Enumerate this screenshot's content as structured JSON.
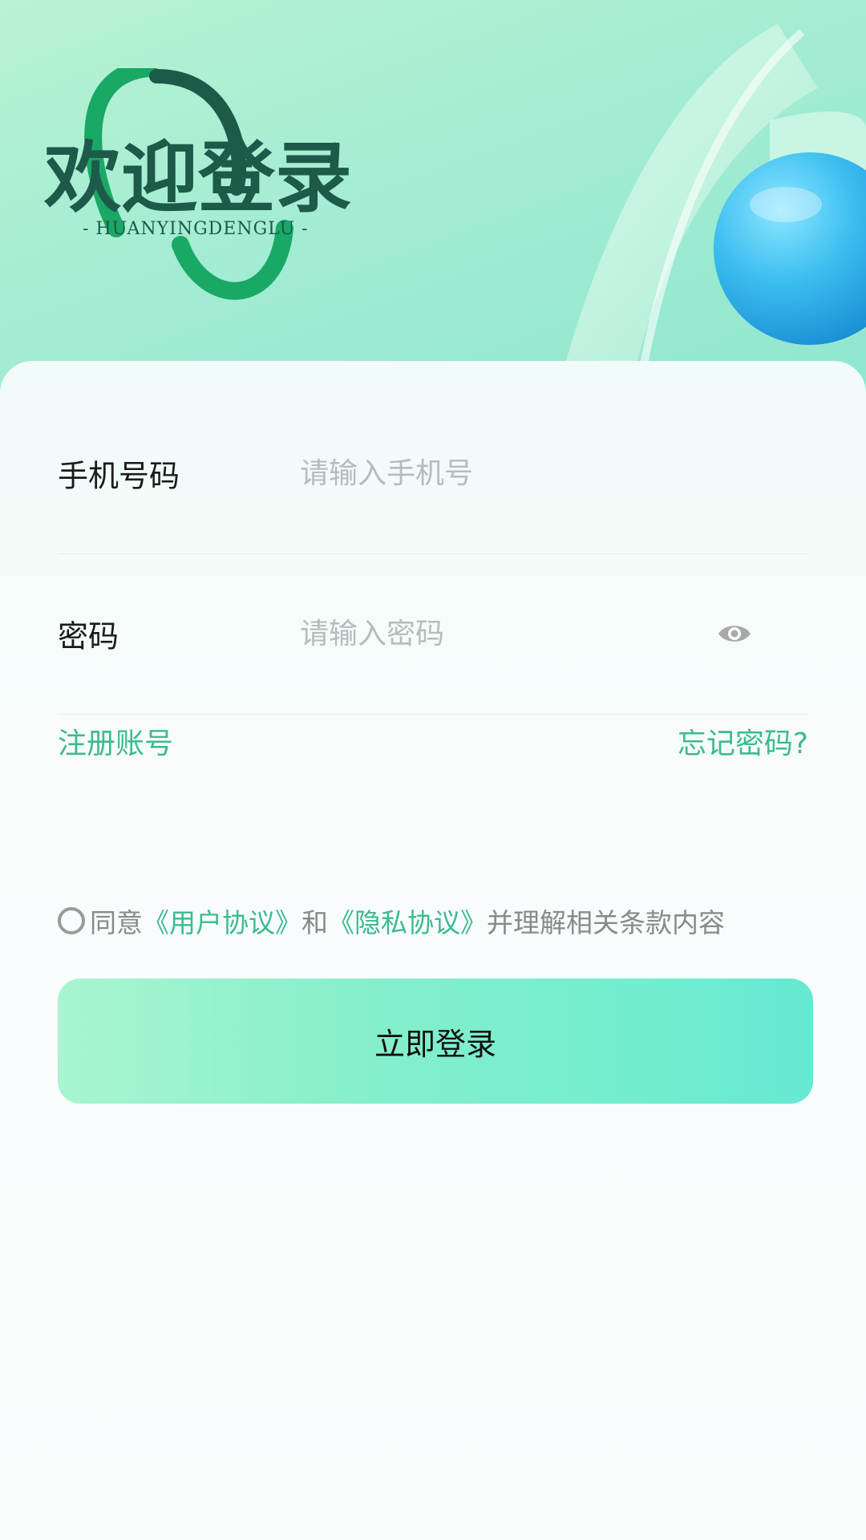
{
  "header": {
    "logo_title": "欢迎登录",
    "logo_subtitle": "- HUANYINGDENGLU -",
    "colors": {
      "dark_green": "#1d5a4a",
      "brand_green": "#19a865",
      "bg_green": "#a3ecd3"
    }
  },
  "form": {
    "phone": {
      "label": "手机号码",
      "placeholder": "请输入手机号",
      "value": ""
    },
    "password": {
      "label": "密码",
      "placeholder": "请输入密码",
      "value": "",
      "toggle_icon": "eye-icon"
    }
  },
  "links": {
    "register": "注册账号",
    "forgot": "忘记密码?"
  },
  "agreement": {
    "checked": false,
    "prefix": "同意",
    "user_agreement": "《用户协议》",
    "conjunction": "和",
    "privacy_agreement": "《隐私协议》",
    "suffix": "并理解相关条款内容"
  },
  "login_button": {
    "label": "立即登录"
  },
  "accent_color": "#3dba91"
}
